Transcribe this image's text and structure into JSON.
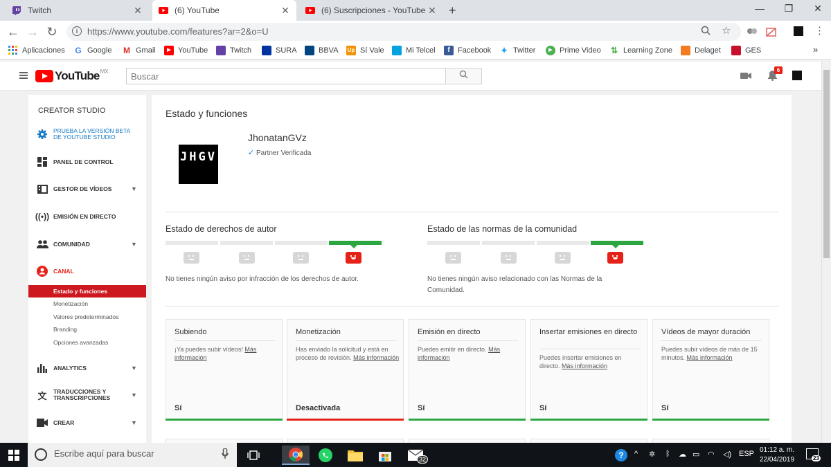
{
  "browser": {
    "tabs": [
      {
        "title": "Twitch",
        "icon": "twitch-icon"
      },
      {
        "title": "(6) YouTube",
        "icon": "youtube-icon"
      },
      {
        "title": "(6) Suscripciones - YouTube",
        "icon": "youtube-icon"
      }
    ],
    "url": "https://www.youtube.com/features?ar=2&o=U",
    "bookmarks": [
      "Aplicaciones",
      "Google",
      "Gmail",
      "YouTube",
      "Twitch",
      "SURA",
      "BBVA",
      "Sí Vale",
      "Mi Telcel",
      "Facebook",
      "Twitter",
      "Prime Video",
      "Learning Zone",
      "Delaget",
      "GES"
    ],
    "bookmarks_more": "»"
  },
  "youtube": {
    "logo_text": "YouTube",
    "region": "MX",
    "search_placeholder": "Buscar",
    "notification_count": "6"
  },
  "sidebar": {
    "header": "CREATOR STUDIO",
    "items": [
      {
        "label": "PRUEBA LA VERSIÓN BETA DE YOUTUBE STUDIO",
        "icon": "gear-icon"
      },
      {
        "label": "PANEL DE CONTROL",
        "icon": "dashboard-icon"
      },
      {
        "label": "GESTOR DE VÍDEOS",
        "icon": "video-manager-icon"
      },
      {
        "label": "EMISIÓN EN DIRECTO",
        "icon": "live-broadcast-icon"
      },
      {
        "label": "COMUNIDAD",
        "icon": "community-icon"
      },
      {
        "label": "CANAL",
        "icon": "channel-icon"
      },
      {
        "label": "ANALYTICS",
        "icon": "analytics-icon"
      },
      {
        "label": "TRADUCCIONES Y TRANSCRIPCIONES",
        "icon": "translate-icon"
      },
      {
        "label": "CREAR",
        "icon": "create-icon"
      }
    ],
    "canal_sub": [
      "Estado y funciones",
      "Monetización",
      "Valores predeterminados",
      "Branding",
      "Opciones avanzadas"
    ]
  },
  "main": {
    "title": "Estado y funciones",
    "channel_name": "JhonatanGVz",
    "avatar_text": "JHGV",
    "partner_check": "✓",
    "partner_status": "Partner Verificada",
    "copyright": {
      "title": "Estado de derechos de autor",
      "description": "No tienes ningún aviso por infracción de los derechos de autor."
    },
    "community": {
      "title": "Estado de las normas de la comunidad",
      "description": "No tienes ningún aviso relacionado con las Normas de la Comunidad."
    },
    "features": [
      {
        "title": "Subiendo",
        "desc": "¡Ya puedes subir vídeos!",
        "link": "Más información",
        "status": "Sí"
      },
      {
        "title": "Monetización",
        "desc": "Has enviado la solicitud y está en proceso de revisión.",
        "link": "Más información",
        "status": "Desactivada"
      },
      {
        "title": "Emisión en directo",
        "desc": "Puedes emitir en directo.",
        "link": "Más información",
        "status": "Sí"
      },
      {
        "title": "Insertar emisiones en directo",
        "desc": "Puedes insertar emisiones en directo.",
        "link": "Más información",
        "status": "Sí"
      },
      {
        "title": "Vídeos de mayor duración",
        "desc": "Puedes subir vídeos de más de 15 minutos.",
        "link": "Más información",
        "status": "Sí"
      }
    ]
  },
  "taskbar": {
    "search_placeholder": "Escribe aquí para buscar",
    "mail_badge": "32",
    "language": "ESP",
    "time": "01:12 a. m.",
    "date": "22/04/2019",
    "notifications": "23"
  },
  "colors": {
    "youtube_red": "#ff0000",
    "status_green": "#2ba640",
    "status_red": "#e62117",
    "active_nav": "#cc181e"
  }
}
